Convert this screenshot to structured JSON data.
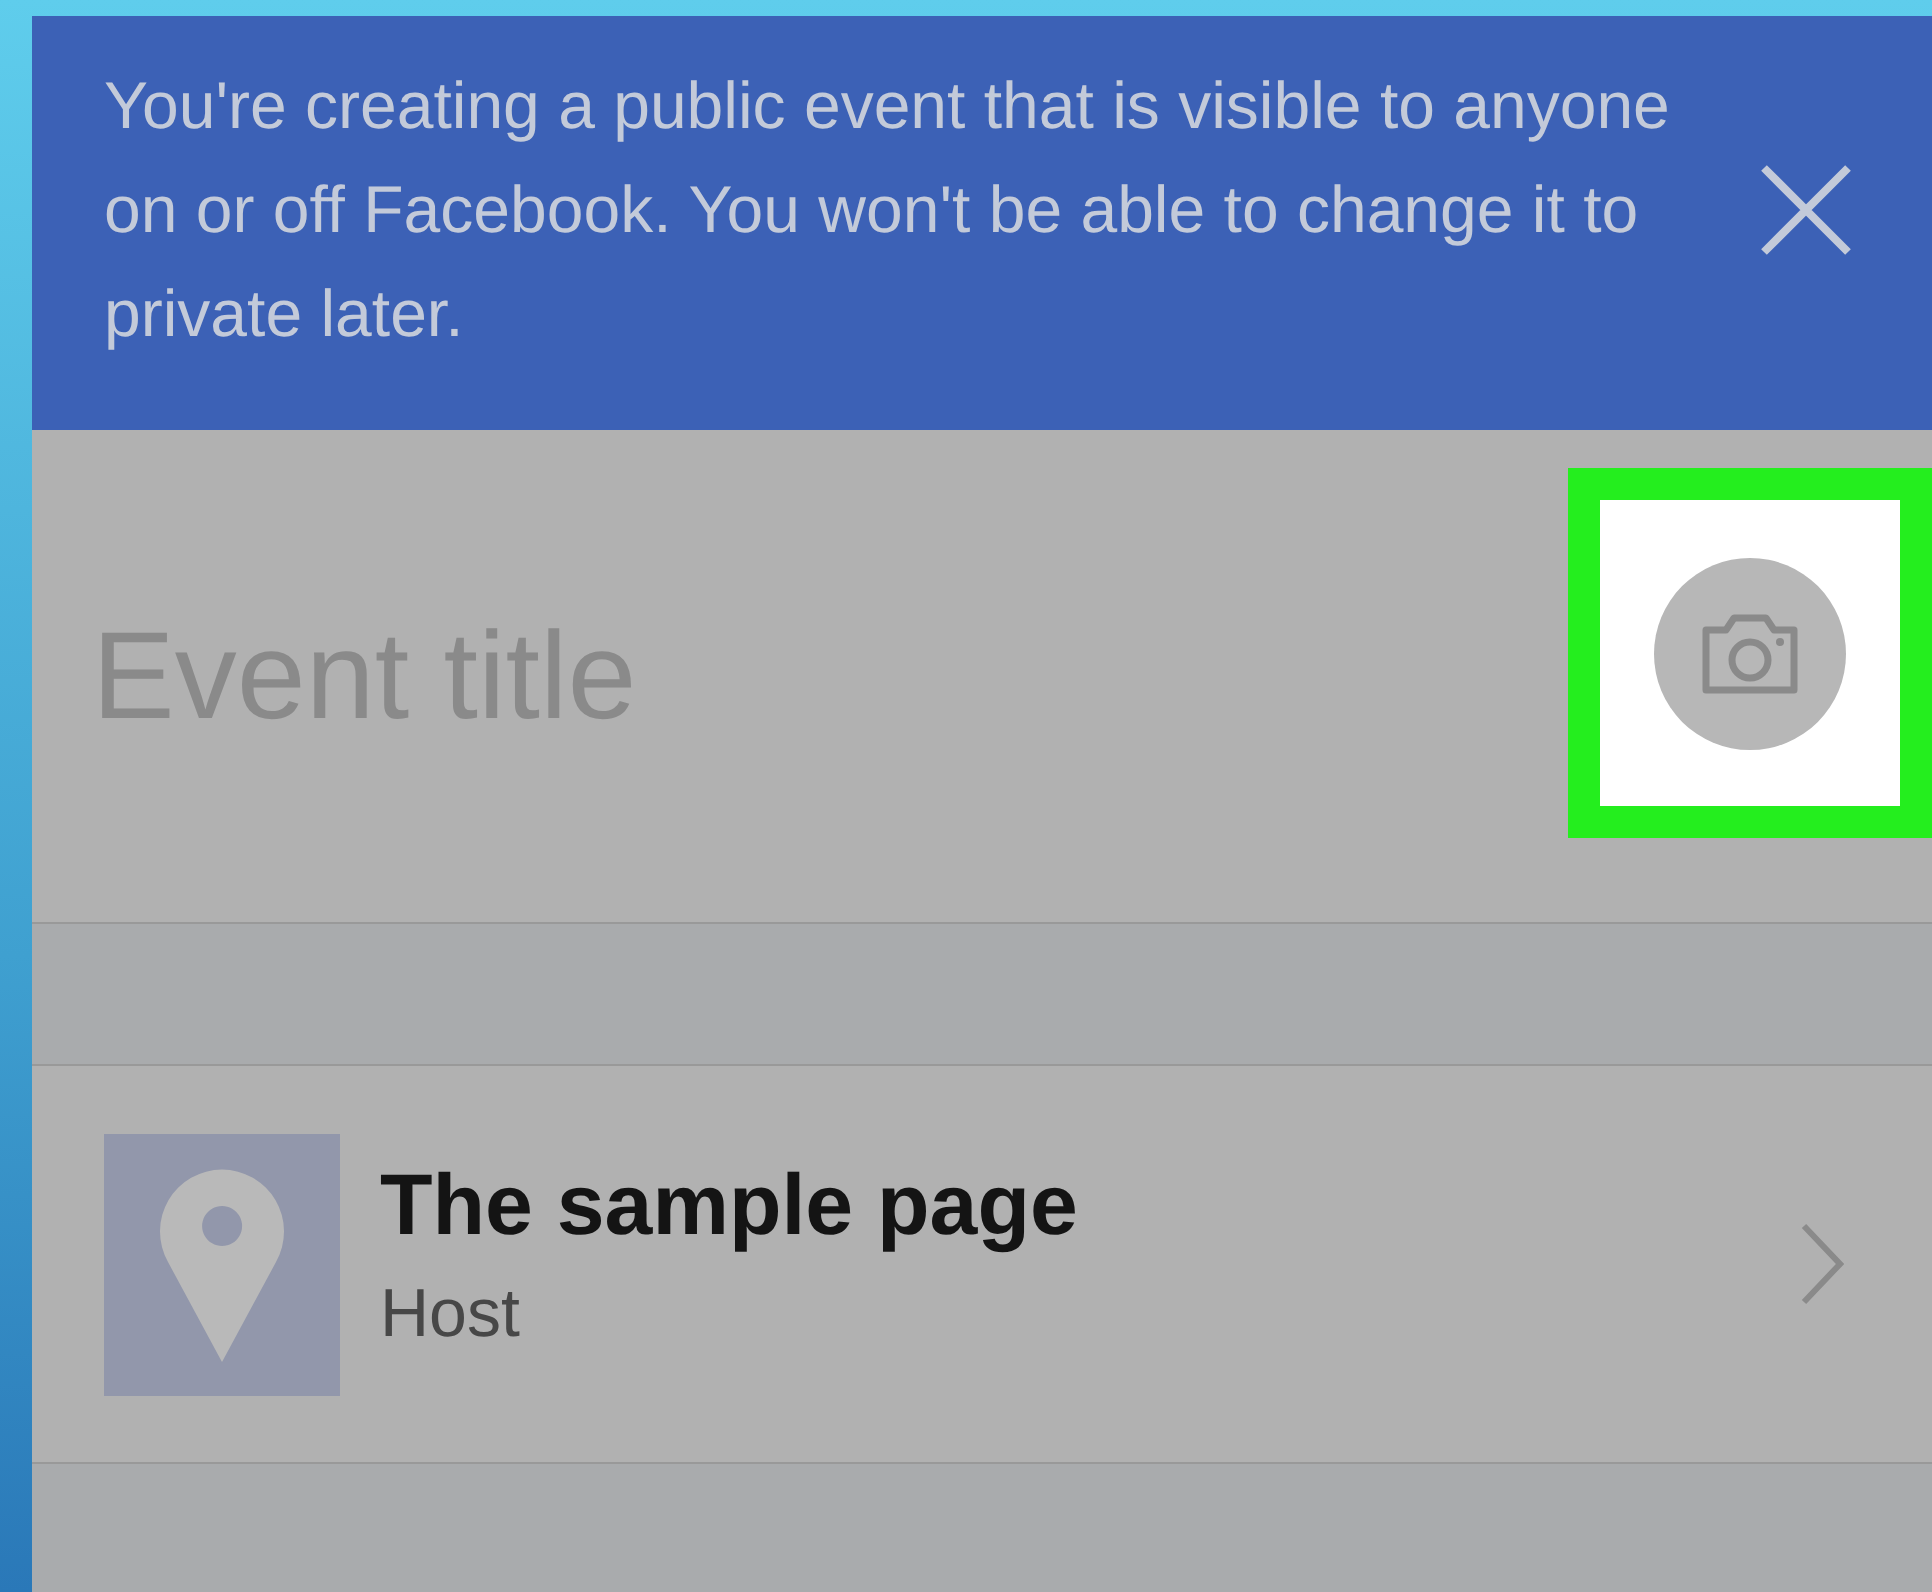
{
  "banner": {
    "text": "You're creating a public event that is visible to anyone on or off Facebook. You won't be able to change it to private later."
  },
  "event_title": {
    "placeholder": "Event title"
  },
  "photo_button": {
    "highlighted": true
  },
  "host": {
    "name": "The sample page",
    "label": "Host"
  }
}
